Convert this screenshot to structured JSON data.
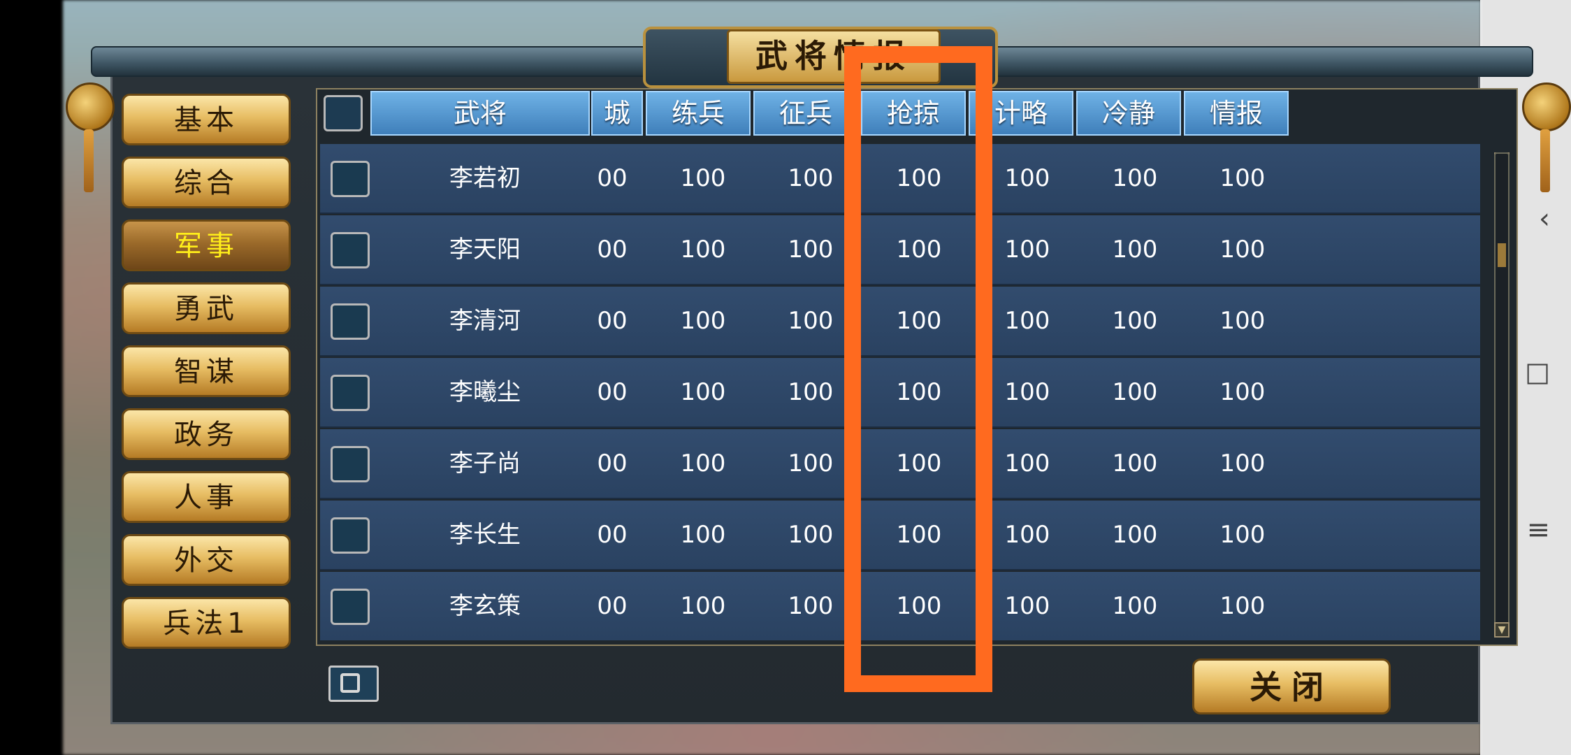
{
  "window": {
    "title": "武将情报"
  },
  "sidebar": {
    "items": [
      {
        "label": "基本",
        "active": false
      },
      {
        "label": "综合",
        "active": false
      },
      {
        "label": "军事",
        "active": true
      },
      {
        "label": "勇武",
        "active": false
      },
      {
        "label": "智谋",
        "active": false
      },
      {
        "label": "政务",
        "active": false
      },
      {
        "label": "人事",
        "active": false
      },
      {
        "label": "外交",
        "active": false
      },
      {
        "label": "兵法1",
        "active": false
      }
    ]
  },
  "table": {
    "columns": [
      "武将",
      "城",
      "练兵",
      "征兵",
      "抢掠",
      "计略",
      "冷静",
      "情报"
    ],
    "rows": [
      {
        "name": "李若初",
        "values": [
          "00",
          "100",
          "100",
          "100",
          "100",
          "100",
          "100"
        ]
      },
      {
        "name": "李天阳",
        "values": [
          "00",
          "100",
          "100",
          "100",
          "100",
          "100",
          "100"
        ]
      },
      {
        "name": "李清河",
        "values": [
          "00",
          "100",
          "100",
          "100",
          "100",
          "100",
          "100"
        ]
      },
      {
        "name": "李曦尘",
        "values": [
          "00",
          "100",
          "100",
          "100",
          "100",
          "100",
          "100"
        ]
      },
      {
        "name": "李子尚",
        "values": [
          "00",
          "100",
          "100",
          "100",
          "100",
          "100",
          "100"
        ]
      },
      {
        "name": "李长生",
        "values": [
          "00",
          "100",
          "100",
          "100",
          "100",
          "100",
          "100"
        ]
      },
      {
        "name": "李玄策",
        "values": [
          "00",
          "100",
          "100",
          "100",
          "100",
          "100",
          "100"
        ]
      }
    ]
  },
  "footer": {
    "close_label": "关闭"
  },
  "colors": {
    "highlight": "#ff6a1f",
    "active_text": "#ffee1a"
  },
  "icons": {
    "search": "search-icon",
    "back": "back-icon",
    "home": "home-icon",
    "menu": "menu-icon"
  }
}
